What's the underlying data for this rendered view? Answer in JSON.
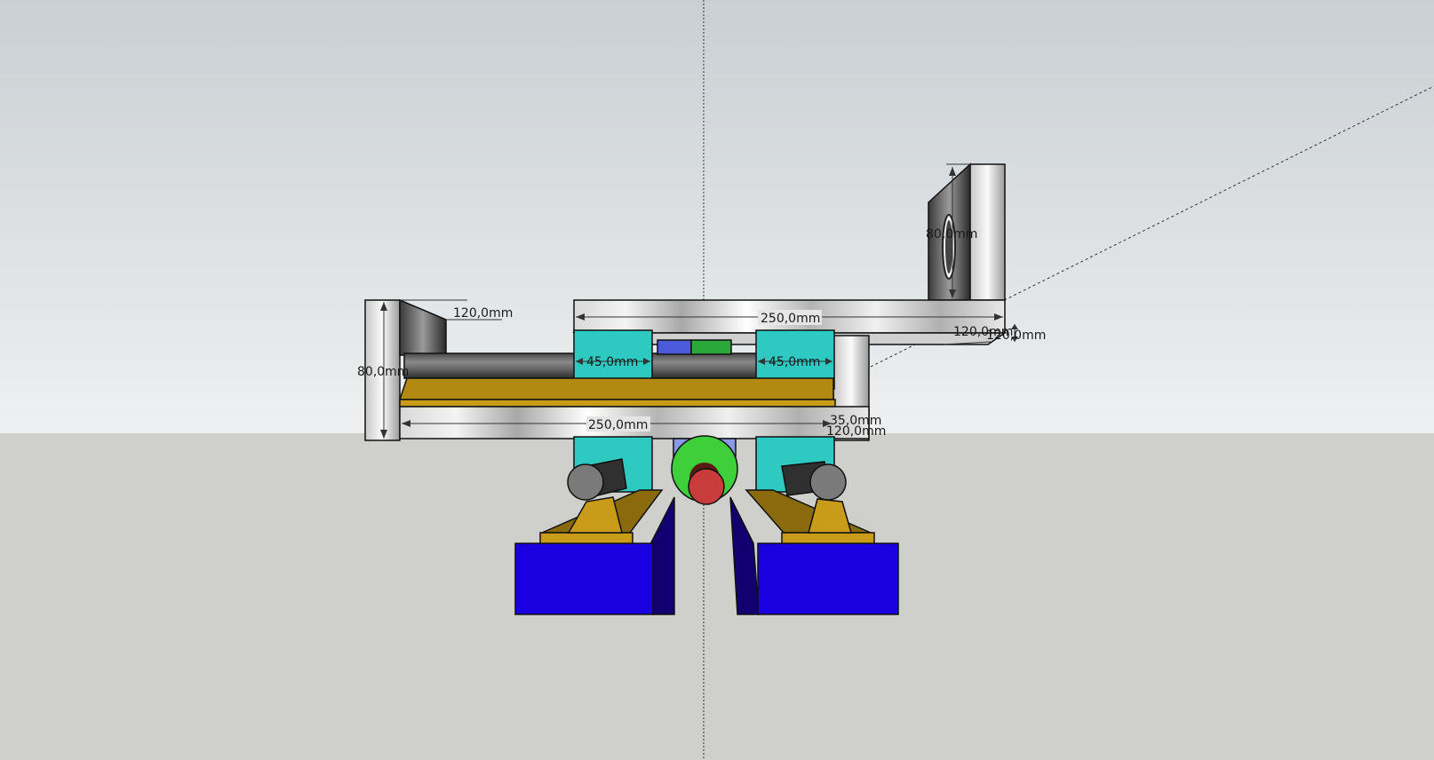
{
  "dimensions": {
    "top_plate_length": "250,0mm",
    "bracket_height_top": "120,0mm",
    "bracket_width_top": "120,0mm",
    "left_bracket_width": "120,0mm",
    "left_bracket_height": "80,0mm",
    "bearing_block_left": "45,0mm",
    "bearing_block_right": "45,0mm",
    "bottom_plate_length": "250,0mm",
    "plate_thickness": "35,0mm",
    "bottom_right_width": "120,0mm",
    "hole_diameter": "80,0mm"
  },
  "colors": {
    "sky_top": "#c9cfd3",
    "sky_bottom": "#eef0f1",
    "ground": "#cfd0cc",
    "cyan_block": "#2ec9c1",
    "gold_rail": "#b28a12",
    "blue_base": "#1a00e0",
    "shaft_gray": "#6a6a6a",
    "green_motor": "#3fcf3a",
    "red_motor": "#c83c3c"
  }
}
